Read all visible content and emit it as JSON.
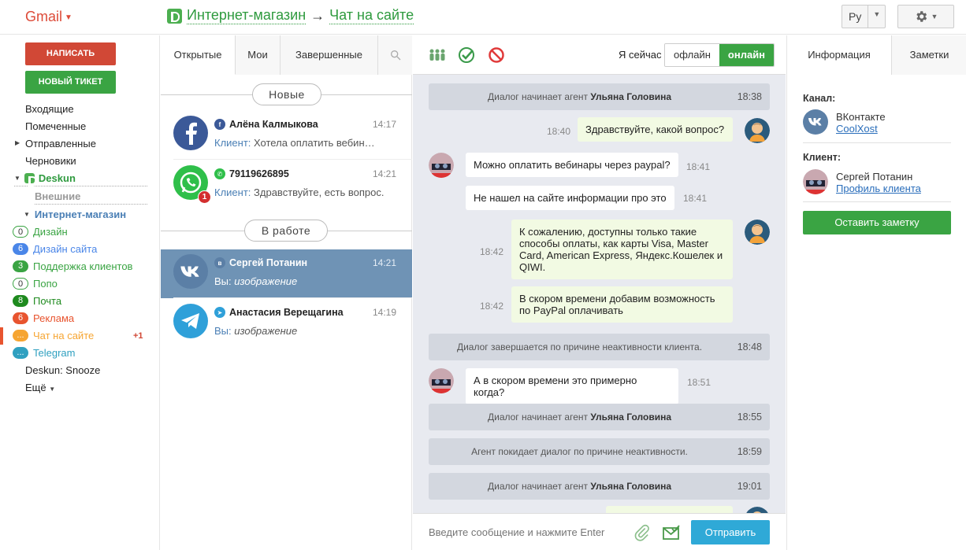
{
  "header": {
    "app_menu": "Gmail",
    "breadcrumb": {
      "root": "Интернет-магазин",
      "arrow": "→",
      "current": "Чат на сайте"
    },
    "language": "Ру"
  },
  "sidebar": {
    "compose_label": "НАПИСАТЬ",
    "new_ticket_label": "НОВЫЙ ТИКЕТ",
    "folders": [
      "Входящие",
      "Помеченные",
      "Отправленные",
      "Черновики"
    ],
    "deskun_label": "Deskun",
    "external_label": "Внешние",
    "shop_label": "Интернет-магазин",
    "labels": [
      {
        "count": "0",
        "name": "Дизайн",
        "color": "#3aa443",
        "style": "outline"
      },
      {
        "count": "6",
        "name": "Дизайн сайта",
        "color": "#4a86e8",
        "style": "fill"
      },
      {
        "count": "3",
        "name": "Поддержка клиентов",
        "color": "#3aa443",
        "style": "fill"
      },
      {
        "count": "0",
        "name": "Попо",
        "color": "#3aa443",
        "style": "outline"
      },
      {
        "count": "8",
        "name": "Почта",
        "color": "#1e8a1e",
        "style": "fill"
      },
      {
        "count": "6",
        "name": "Реклама",
        "color": "#e8542f",
        "style": "fill"
      },
      {
        "count": "...",
        "name": "Чат на сайте",
        "color": "#f6a532",
        "style": "fill",
        "extra": "+1"
      },
      {
        "count": "...",
        "name": "Telegram",
        "color": "#2fa0c0",
        "style": "fill"
      }
    ],
    "snooze_label": "Deskun: Snooze",
    "more_label": "Ещё"
  },
  "conv_list": {
    "tabs": [
      "Открытые",
      "Мои",
      "Завершенные"
    ],
    "section_new": "Новые",
    "section_work": "В работе",
    "items": [
      {
        "name": "Алёна Калмыкова",
        "time": "14:17",
        "who": "Клиент:",
        "preview": "Хотела оплатить вебин…",
        "channel": "facebook"
      },
      {
        "name": "79119626895",
        "time": "14:21",
        "who": "Клиент:",
        "preview": "Здравствуйте, есть вопрос.",
        "channel": "whatsapp",
        "unread": "1"
      },
      {
        "name": "Сергей Потанин",
        "time": "14:21",
        "who": "Вы:",
        "preview": "изображение",
        "channel": "vk",
        "selected": true
      },
      {
        "name": "Анастасия Верещагина",
        "time": "14:19",
        "who": "Вы:",
        "preview": "изображение",
        "channel": "telegram"
      }
    ]
  },
  "chat": {
    "status_label": "Я сейчас",
    "offline_label": "офлайн",
    "online_label": "онлайн",
    "messages": [
      {
        "type": "system",
        "text": "Диалог начинает агент ",
        "bold": "Ульяна Головина",
        "time": "18:38"
      },
      {
        "type": "out",
        "text": "Здравствуйте, какой вопрос?",
        "time": "18:40"
      },
      {
        "type": "in",
        "text": "Можно оплатить вебинары через paypal?",
        "time": "18:41"
      },
      {
        "type": "in",
        "text": "Не нашел на сайте информации про это",
        "time": "18:41"
      },
      {
        "type": "out",
        "text": "К сожалению, доступны только такие способы оплаты, как карты Visa, Master Card, American Express, Яндекс.Кошелек и QIWI.",
        "time": "18:42"
      },
      {
        "type": "out",
        "text": "В скором времени добавим возможность по PayPal оплачивать",
        "time": "18:42"
      },
      {
        "type": "system",
        "text": "Диалог завершается по причине неактивности клиента.",
        "bold": "",
        "time": "18:48"
      },
      {
        "type": "in",
        "text": "А в скором времени это примерно когда?",
        "time": "18:51"
      },
      {
        "type": "system",
        "text": "Диалог начинает агент ",
        "bold": "Ульяна Головина",
        "time": "18:55"
      },
      {
        "type": "system",
        "text": "Агент покидает диалог по причине неактивности.",
        "bold": "",
        "time": "18:59"
      },
      {
        "type": "system",
        "text": "Диалог начинает агент ",
        "bold": "Ульяна Головина",
        "time": "19:01"
      }
    ],
    "input_placeholder": "Введите сообщение и нажмите Enter",
    "send_label": "Отправить"
  },
  "info": {
    "tabs": [
      "Информация",
      "Заметки"
    ],
    "channel_heading": "Канал:",
    "channel_name": "ВКонтакте",
    "channel_link": "CoolXost",
    "client_heading": "Клиент:",
    "client_name": "Сергей Потанин",
    "client_link": "Профиль клиента",
    "note_button": "Оставить заметку"
  }
}
